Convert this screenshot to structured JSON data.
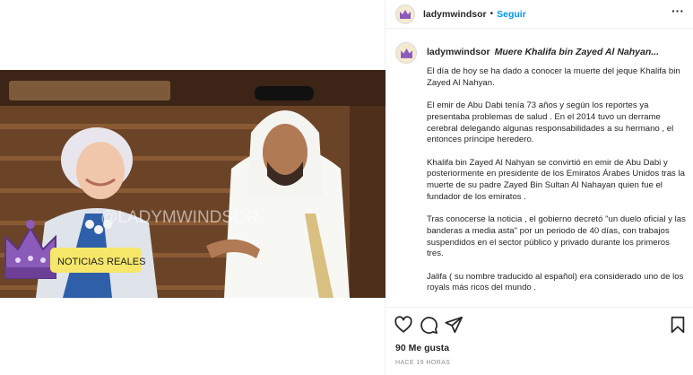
{
  "post": {
    "username": "ladymwindsor",
    "follow_label": "Seguir",
    "separator": "•",
    "more_label": "···",
    "caption_title": "Muere Khalifa bin Zayed Al Nahyan...",
    "paragraphs": [
      "El día de hoy se ha dado a conocer la muerte del jeque Khalifa bin Zayed Al Nahyan.",
      "El emir de Abu Dabi tenía 73 años y según los reportes ya presentaba problemas de salud . En el 2014 tuvo un derrame cerebral delegando algunas responsabilidades a su hermano , el entonces príncipe heredero.",
      "Khalifa bin Zayed Al Nahyan se convirtió en emir de Abu Dabi y posteriormente en presidente de los Emiratos Árabes Unidos tras la muerte de su padre Zayed Bin Sultan Al Nahayan quien fue el fundador de los emiratos .",
      "Tras conocerse la noticia , el gobierno decretó \"un duelo oficial y las banderas a media asta\" por un periodo de 40 días, con trabajos suspendidos en el sector público y privado durante los primeros tres.",
      "Jalifa ( su nombre traducido al español) era considerado uno de los royals más ricos del mundo ."
    ],
    "likes": "90 Me gusta",
    "time_ago": "HACE 19 HORAS"
  },
  "image": {
    "watermark": "@LADYMWINDSOR",
    "badge_label": "NOTICIAS REALES",
    "icon": "crown-logo"
  },
  "icons": {
    "like": "heart-icon",
    "comment": "comment-icon",
    "share": "share-icon",
    "save": "bookmark-icon",
    "more": "more-icon",
    "avatar": "crown-avatar-icon"
  },
  "colors": {
    "follow": "#0095f6",
    "text": "#262626",
    "muted": "#8e8e8e",
    "badge": "#f6e76a"
  }
}
